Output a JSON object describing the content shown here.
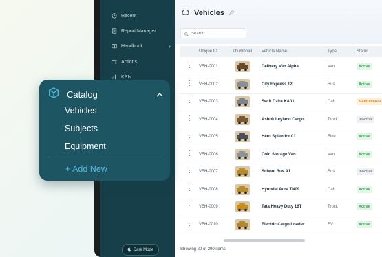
{
  "sidebar": {
    "items": [
      {
        "label": "Recent",
        "icon": "clock-icon"
      },
      {
        "label": "Report Manager",
        "icon": "report-icon"
      },
      {
        "label": "Handbook",
        "icon": "book-icon"
      },
      {
        "label": "Actions",
        "icon": "actions-icon"
      },
      {
        "label": "KPIs",
        "icon": "kpi-icon"
      }
    ],
    "dark_mode_label": "Dark Mode"
  },
  "header": {
    "title": "Vehicles"
  },
  "search": {
    "placeholder": "Search"
  },
  "table": {
    "columns": [
      "Unique ID",
      "Thumbnail",
      "Vehicle Name",
      "Type",
      "Status"
    ],
    "rows": [
      {
        "id": "VEH-0001",
        "name": "Delivery Van Alpha",
        "type": "Van",
        "status": "Active",
        "thumb_color": "#6b4a2a"
      },
      {
        "id": "VEH-0002",
        "name": "City Express 12",
        "type": "Bus",
        "status": "Active",
        "thumb_color": "#8a8f96"
      },
      {
        "id": "VEH-0003",
        "name": "Swift Dzire KA01",
        "type": "Cab",
        "status": "Maintenance",
        "thumb_color": "#7d8288"
      },
      {
        "id": "VEH-0004",
        "name": "Ashok Leyland Cargo",
        "type": "Truck",
        "status": "Inactive",
        "thumb_color": "#7a5a34"
      },
      {
        "id": "VEH-0005",
        "name": "Hero Splendor 01",
        "type": "Bike",
        "status": "Active",
        "thumb_color": "#4a4f55"
      },
      {
        "id": "VEH-0006",
        "name": "Cold Storage Van",
        "type": "Van",
        "status": "Active",
        "thumb_color": "#8d9298"
      },
      {
        "id": "VEH-0007",
        "name": "School Bus A1",
        "type": "Bus",
        "status": "Inactive",
        "thumb_color": "#b98a2a"
      },
      {
        "id": "VEH-0008",
        "name": "Hyundai Aura TN09",
        "type": "Cab",
        "status": "Active",
        "thumb_color": "#b88a2e"
      },
      {
        "id": "VEH-0009",
        "name": "Tata Heavy Duty 16T",
        "type": "Truck",
        "status": "Active",
        "thumb_color": "#c98f1e"
      },
      {
        "id": "VEH-0010",
        "name": "Electric Cargo Loader",
        "type": "EV",
        "status": "Active",
        "thumb_color": "#b0892e"
      }
    ]
  },
  "footer": {
    "showing": "Showing 20 of 200 items"
  },
  "catalog": {
    "title": "Catalog",
    "items": [
      "Vehicles",
      "Subjects",
      "Equipment"
    ],
    "add_new": "+ Add New"
  },
  "colors": {
    "sidebar_bg": "#163f49",
    "catalog_bg": "#1e5563",
    "accent": "#4fb9e0",
    "active_badge_bg": "#e3f5e7",
    "active_badge_text": "#3aa55a",
    "maintenance_badge_bg": "#fdf0de",
    "maintenance_badge_text": "#e08a1e",
    "inactive_badge_bg": "#eef0f2",
    "inactive_badge_text": "#7a8590"
  }
}
